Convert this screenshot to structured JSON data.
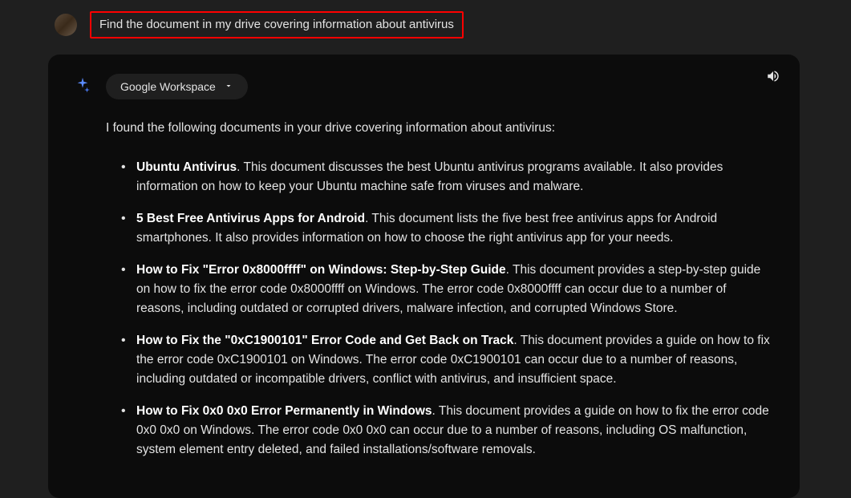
{
  "user_prompt": "Find the document in my drive covering information about antivirus",
  "workspace_chip": "Google Workspace",
  "intro": "I found the following documents in your drive covering information about antivirus:",
  "results": [
    {
      "title": "Ubuntu Antivirus",
      "description": ". This document discusses the best Ubuntu antivirus programs available. It also provides information on how to keep your Ubuntu machine safe from viruses and malware."
    },
    {
      "title": "5 Best Free Antivirus Apps for Android",
      "description": ". This document lists the five best free antivirus apps for Android smartphones. It also provides information on how to choose the right antivirus app for your needs."
    },
    {
      "title": "How to Fix \"Error 0x8000ffff\" on Windows: Step-by-Step Guide",
      "description": ". This document provides a step-by-step guide on how to fix the error code 0x8000ffff on Windows. The error code 0x8000ffff can occur due to a number of reasons, including outdated or corrupted drivers, malware infection, and corrupted Windows Store."
    },
    {
      "title": "How to Fix the \"0xC1900101\" Error Code and Get Back on Track",
      "description": ". This document provides a guide on how to fix the error code 0xC1900101 on Windows. The error code 0xC1900101 can occur due to a number of reasons, including outdated or incompatible drivers, conflict with antivirus, and insufficient space."
    },
    {
      "title": "How to Fix 0x0 0x0 Error Permanently in Windows",
      "description": ". This document provides a guide on how to fix the error code 0x0 0x0 on Windows. The error code 0x0 0x0 can occur due to a number of reasons, including OS malfunction, system element entry deleted, and failed installations/software removals."
    }
  ]
}
